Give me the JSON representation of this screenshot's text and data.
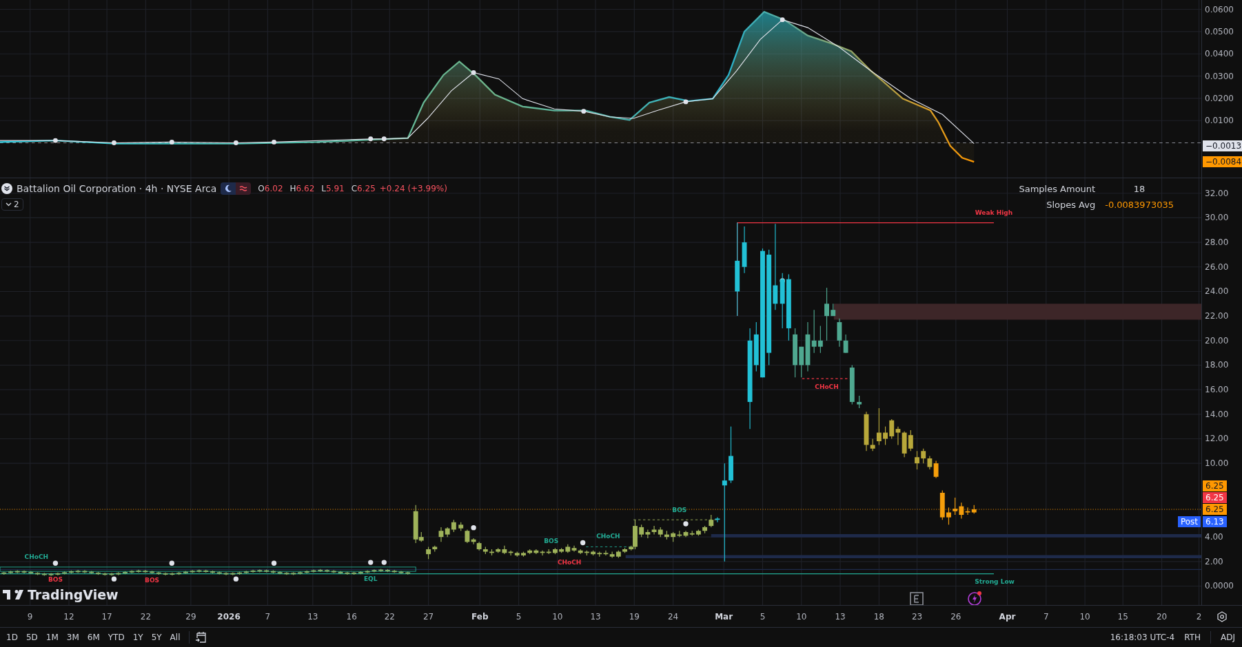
{
  "indicator_pane": {
    "axis_labels": [
      "0.0600",
      "0.0500",
      "0.0400",
      "0.0300",
      "0.0200",
      "0.0100"
    ],
    "badges": [
      {
        "text": "−0.0013",
        "kind": "neutral"
      },
      {
        "text": "−0.0084",
        "kind": "orange"
      }
    ]
  },
  "legend": {
    "title": "Battalion Oil Corporation · 4h · NYSE Arca",
    "ohlc": [
      {
        "label": "O",
        "value": "6.02"
      },
      {
        "label": "H",
        "value": "6.62"
      },
      {
        "label": "L",
        "value": "5.91"
      },
      {
        "label": "C",
        "value": "6.25"
      }
    ],
    "change": "+0.24 (+3.99%)",
    "collapse_count": "2"
  },
  "stats_table": [
    {
      "label": "Samples Amount",
      "value": "18",
      "kind": "plain"
    },
    {
      "label": "Slopes Avg",
      "value": "-0.0083973035",
      "kind": "accent"
    }
  ],
  "price_axis": {
    "labels": [
      "32.00",
      "30.00",
      "28.00",
      "26.00",
      "24.00",
      "22.00",
      "20.00",
      "18.00",
      "16.00",
      "14.00",
      "12.00",
      "10.00",
      "4.00",
      "2.00",
      "0.0000"
    ],
    "badges": [
      {
        "text": "6.25",
        "kind": "orange"
      },
      {
        "text": "6.25",
        "kind": "red"
      },
      {
        "text": "6.25",
        "kind": "orange"
      },
      {
        "text": "6.13",
        "kind": "blue",
        "tag": "Post"
      }
    ]
  },
  "chart_labels": [
    {
      "text": "Weak High",
      "color": "#f23645"
    },
    {
      "text": "CHoCH",
      "color": "#f23645"
    },
    {
      "text": "CHoCH",
      "color": "#22ab94"
    },
    {
      "text": "BOS",
      "color": "#f23645"
    },
    {
      "text": "BOS",
      "color": "#f23645"
    },
    {
      "text": "EQL",
      "color": "#22ab94"
    },
    {
      "text": "BOS",
      "color": "#22ab94"
    },
    {
      "text": "CHoCH",
      "color": "#f23645"
    },
    {
      "text": "CHoCH",
      "color": "#22ab94"
    },
    {
      "text": "BOS",
      "color": "#22ab94"
    },
    {
      "text": "Strong Low",
      "color": "#22ab94"
    }
  ],
  "logo": "TradingView",
  "time_axis": {
    "labels": [
      {
        "text": "9",
        "kind": "day"
      },
      {
        "text": "12",
        "kind": "day"
      },
      {
        "text": "17",
        "kind": "day"
      },
      {
        "text": "22",
        "kind": "day"
      },
      {
        "text": "29",
        "kind": "day"
      },
      {
        "text": "2026",
        "kind": "major"
      },
      {
        "text": "7",
        "kind": "day"
      },
      {
        "text": "13",
        "kind": "day"
      },
      {
        "text": "16",
        "kind": "day"
      },
      {
        "text": "22",
        "kind": "day"
      },
      {
        "text": "27",
        "kind": "day"
      },
      {
        "text": "Feb",
        "kind": "major"
      },
      {
        "text": "5",
        "kind": "day"
      },
      {
        "text": "10",
        "kind": "day"
      },
      {
        "text": "13",
        "kind": "day"
      },
      {
        "text": "19",
        "kind": "day"
      },
      {
        "text": "24",
        "kind": "day"
      },
      {
        "text": "Mar",
        "kind": "major"
      },
      {
        "text": "5",
        "kind": "day"
      },
      {
        "text": "10",
        "kind": "day"
      },
      {
        "text": "13",
        "kind": "day"
      },
      {
        "text": "18",
        "kind": "day"
      },
      {
        "text": "23",
        "kind": "day"
      },
      {
        "text": "26",
        "kind": "day"
      },
      {
        "text": "Apr",
        "kind": "major"
      },
      {
        "text": "7",
        "kind": "day"
      },
      {
        "text": "10",
        "kind": "day"
      },
      {
        "text": "15",
        "kind": "day"
      },
      {
        "text": "20",
        "kind": "day"
      },
      {
        "text": "2",
        "kind": "day"
      }
    ]
  },
  "range_buttons": [
    "1D",
    "5D",
    "1M",
    "3M",
    "6M",
    "YTD",
    "1Y",
    "5Y",
    "All"
  ],
  "status": {
    "time": "16:18:03 UTC-4",
    "session": "RTH",
    "adjustment": "ADJ"
  }
}
